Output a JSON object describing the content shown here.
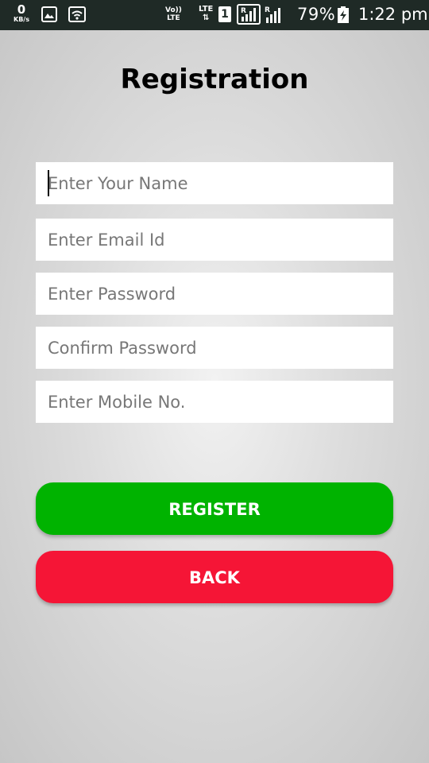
{
  "status_bar": {
    "data_rate": "0",
    "data_rate_unit": "KB/s",
    "volte_line1": "Vo))",
    "volte_line2": "LTE",
    "lte_label": "LTE",
    "lte_arrows": "⇅",
    "sim_slot": "1",
    "battery_percent": "79%",
    "time": "1:22 pm",
    "icons": [
      "image-icon",
      "wifi-icon",
      "signal-icon",
      "signal-roaming-icon",
      "battery-charging-icon"
    ],
    "background_color": "#1f2a26"
  },
  "page": {
    "title": "Registration"
  },
  "form": {
    "fields": [
      {
        "placeholder": "Enter Your Name",
        "value": "",
        "focused": true
      },
      {
        "placeholder": "Enter Email Id",
        "value": ""
      },
      {
        "placeholder": "Enter Password",
        "value": ""
      },
      {
        "placeholder": "Confirm Password",
        "value": ""
      },
      {
        "placeholder": "Enter Mobile No.",
        "value": ""
      }
    ]
  },
  "buttons": {
    "register_label": "REGISTER",
    "register_color": "#00b300",
    "back_label": "BACK",
    "back_color": "#f51536"
  }
}
